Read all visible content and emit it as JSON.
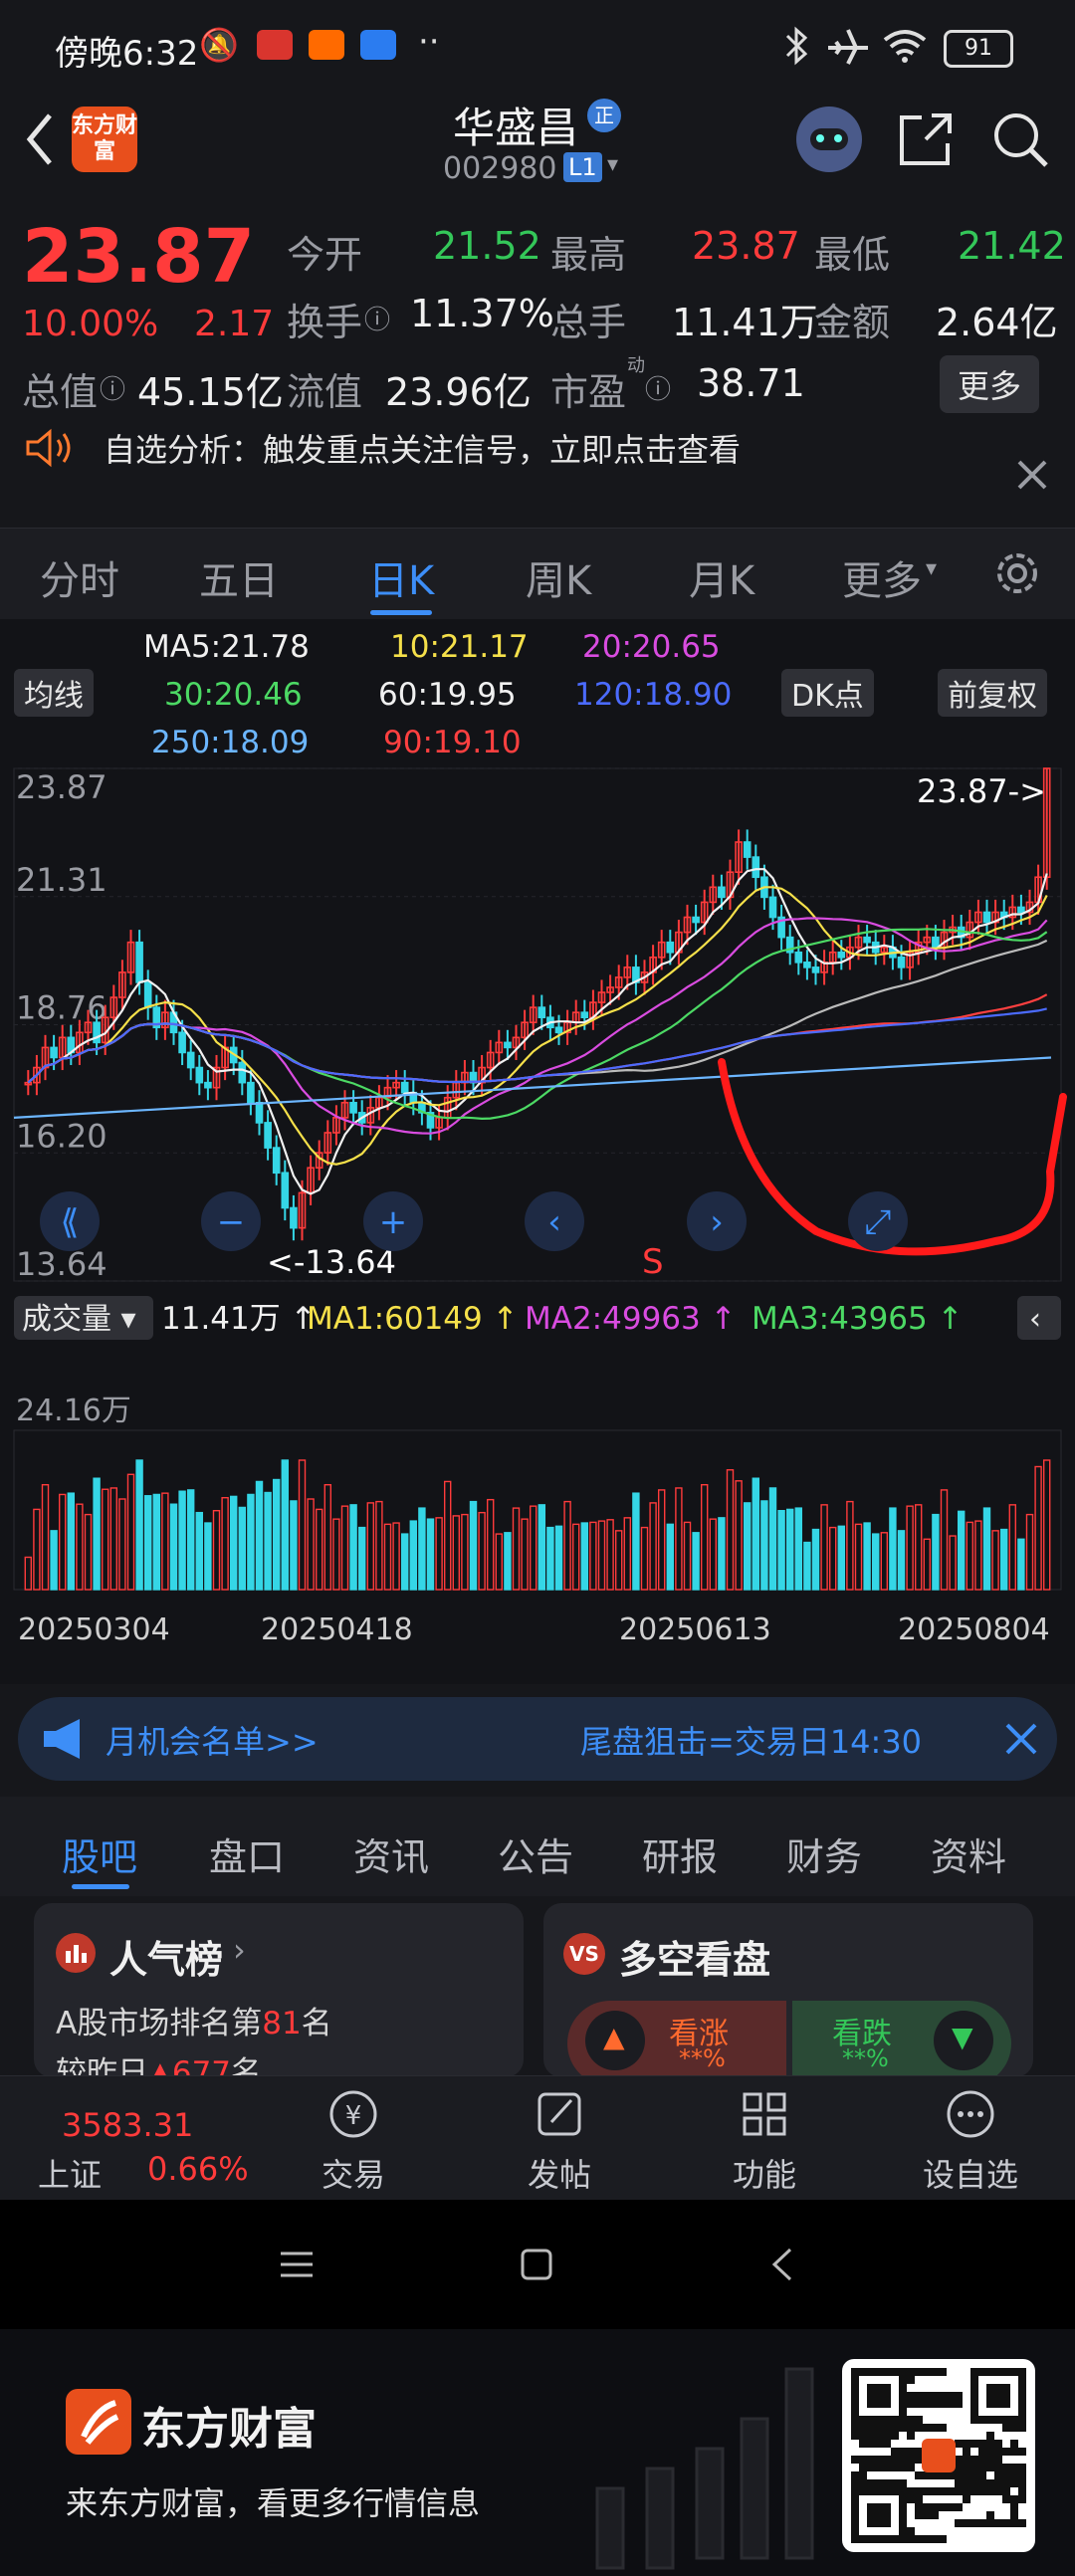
{
  "status_bar": {
    "time": "傍晚6:32",
    "battery": "91",
    "more": "··"
  },
  "header": {
    "stock_name": "华盛昌",
    "badge": "正",
    "code": "002980",
    "level": "L1"
  },
  "quote": {
    "price": "23.87",
    "change_pct": "10.00%",
    "change": "2.17",
    "open_label": "今开",
    "open": "21.52",
    "high_label": "最高",
    "high": "23.87",
    "low_label": "最低",
    "low": "21.42",
    "turnover_label": "换手",
    "turnover": "11.37%",
    "volume_label": "总手",
    "volume": "11.41万",
    "amount_label": "金额",
    "amount": "2.64亿",
    "mktcap_label": "总值",
    "mktcap": "45.15亿",
    "float_label": "流值",
    "float": "23.96亿",
    "pe_label": "市盈",
    "pe_sup": "动",
    "pe": "38.71",
    "more_button": "更多"
  },
  "notice": {
    "text": "自选分析：触发重点关注信号，立即点击查看"
  },
  "kline_tabs": [
    "分时",
    "五日",
    "日K",
    "周K",
    "月K",
    "更多"
  ],
  "kline_active": 2,
  "ma_legend": {
    "ma5": "MA5:21.78",
    "ma10": "10:21.17",
    "ma20": "20:20.65",
    "ma30": "30:20.46",
    "ma60": "60:19.95",
    "ma120": "120:18.90",
    "ma250": "250:18.09",
    "ma90": "90:19.10",
    "ma_select": "均线",
    "dk_button": "DK点",
    "adjust_button": "前复权"
  },
  "chart_data": {
    "type": "candlestick",
    "price_axis": [
      "23.87",
      "21.31",
      "18.76",
      "16.20",
      "13.64"
    ],
    "ylim": [
      13.64,
      23.87
    ],
    "last_price_label": "23.87->",
    "low_marker_label": "<-13.64",
    "s_marker": "S",
    "closes": [
      17.6,
      17.9,
      18.3,
      18.1,
      18.5,
      18.2,
      18.6,
      18.8,
      18.4,
      18.9,
      19.3,
      19.8,
      20.4,
      19.6,
      19.1,
      18.7,
      19.0,
      18.6,
      18.2,
      17.9,
      17.6,
      17.5,
      17.9,
      18.3,
      18.0,
      17.6,
      17.2,
      16.8,
      16.3,
      15.8,
      15.1,
      14.7,
      15.4,
      15.9,
      16.2,
      16.6,
      16.9,
      17.2,
      17.0,
      16.8,
      17.1,
      17.3,
      17.5,
      17.6,
      17.4,
      17.2,
      17.0,
      16.7,
      16.9,
      17.3,
      17.6,
      17.8,
      17.6,
      17.9,
      18.2,
      18.4,
      18.3,
      18.5,
      18.8,
      19.1,
      18.9,
      18.7,
      18.6,
      18.8,
      19.0,
      18.9,
      19.2,
      19.4,
      19.5,
      19.7,
      19.9,
      19.6,
      19.8,
      20.1,
      20.4,
      20.2,
      20.6,
      20.9,
      20.8,
      21.2,
      21.5,
      21.3,
      21.8,
      22.4,
      22.1,
      21.7,
      21.3,
      20.9,
      20.5,
      20.2,
      20.0,
      19.9,
      19.8,
      20.0,
      20.2,
      20.1,
      20.3,
      20.5,
      20.4,
      20.2,
      20.3,
      20.1,
      19.9,
      20.2,
      20.4,
      20.5,
      20.3,
      20.6,
      20.7,
      20.5,
      20.8,
      21.0,
      20.8,
      21.0,
      20.9,
      21.1,
      21.0,
      21.2,
      21.7,
      23.87
    ],
    "volume_legend": {
      "label": "成交量",
      "vol": "11.41万",
      "ma1": "MA1:60149",
      "ma2": "MA2:49963",
      "ma3": "MA3:43965"
    },
    "volume_axis_max": "24.16万",
    "dates": [
      "20250304",
      "20250418",
      "20250613",
      "20250804"
    ]
  },
  "banner": {
    "left": "月机会名单>>",
    "right": "尾盘狙击=交易日14:30"
  },
  "bottom_tabs": [
    "股吧",
    "盘口",
    "资讯",
    "公告",
    "研报",
    "财务",
    "资料"
  ],
  "bottom_active": 0,
  "cards": {
    "popularity_title": "人气榜",
    "popularity_rank_prefix": "A股市场排名第",
    "popularity_rank": "81",
    "popularity_rank_suffix": "名",
    "popularity_change": "较昨日",
    "popularity_change_val": "677",
    "popularity_change_suffix": "名",
    "ls_title": "多空看盘",
    "bull": "看涨",
    "bull_pct": "**%",
    "bear": "看跌",
    "bear_pct": "**%"
  },
  "footer_nav": {
    "index_value": "3583.31",
    "index_name": "上证",
    "index_pct": "0.66%",
    "items": [
      "交易",
      "发帖",
      "功能",
      "设自选"
    ]
  },
  "promo": {
    "brand": "东方财富",
    "slogan": "来东方财富，看更多行情信息"
  },
  "logo_text": "东方财富"
}
